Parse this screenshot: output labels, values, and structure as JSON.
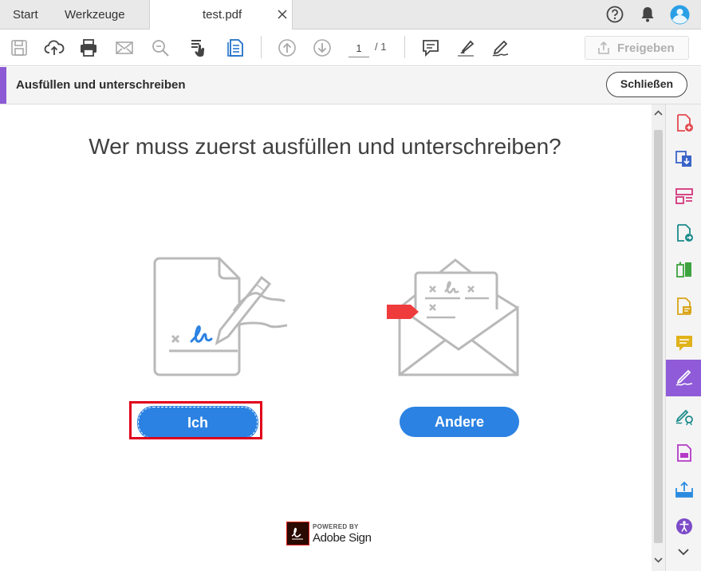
{
  "tabs": {
    "start": "Start",
    "tools": "Werkzeuge",
    "document": "test.pdf"
  },
  "toolbar": {
    "page_current": "1",
    "page_total": "/ 1",
    "share_label": "Freigeben"
  },
  "fill_sign_bar": {
    "title": "Ausfüllen und unterschreiben",
    "close_label": "Schließen"
  },
  "main": {
    "heading": "Wer muss zuerst ausfüllen und unterschreiben?",
    "option_me": "Ich",
    "option_others": "Andere"
  },
  "powered_by": {
    "small": "POWERED BY",
    "brand": "Adobe Sign"
  },
  "icons": {
    "top_toolbar": [
      "help-icon",
      "notification-bell-icon",
      "profile-avatar-icon"
    ],
    "document_toolbar": [
      "save-icon",
      "upload-cloud-icon",
      "print-icon",
      "email-icon",
      "zoom-icon",
      "select-tool-icon",
      "page-tool-icon",
      "previous-page-icon",
      "next-page-icon",
      "comment-icon",
      "highlight-icon",
      "sign-pen-icon",
      "share-icon"
    ],
    "right_panel": [
      "create-pdf-icon",
      "combine-files-icon",
      "organize-pages-icon",
      "export-pdf-icon",
      "edit-pdf-icon",
      "scan-icon",
      "comment-tool-icon",
      "fill-sign-tool-icon",
      "send-for-signature-icon",
      "protect-pdf-icon",
      "send-review-icon",
      "accessibility-icon"
    ]
  },
  "colors": {
    "accent_purple": "#8d5ad6",
    "button_blue": "#2b82e2",
    "highlight_red": "#e0001b",
    "flag_red": "#ef3b3b"
  }
}
